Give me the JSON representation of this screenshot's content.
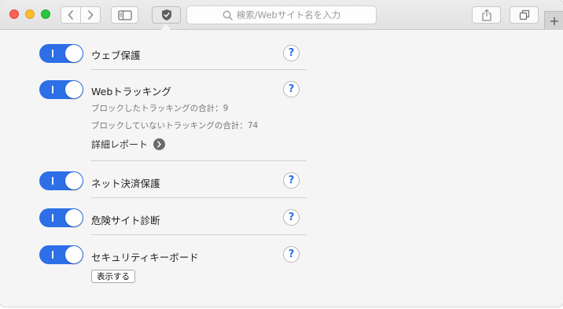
{
  "toolbar": {
    "address_placeholder": "検索/Webサイト名を入力"
  },
  "settings": [
    {
      "label": "ウェブ保護",
      "enabled": true
    },
    {
      "label": "Webトラッキング",
      "enabled": true,
      "blocked_text": "ブロックしたトラッキングの合計：9",
      "unblocked_text": "ブロックしていないトラッキングの合計：74",
      "detail_link": "詳細レポート"
    },
    {
      "label": "ネット決済保護",
      "enabled": true
    },
    {
      "label": "危険サイト診断",
      "enabled": true
    },
    {
      "label": "セキュリティキーボード",
      "enabled": true,
      "button_label": "表示する"
    }
  ],
  "help_glyph": "?",
  "colors": {
    "toggle_on": "#2d6fe6",
    "help_accent": "#2d6fe6"
  }
}
